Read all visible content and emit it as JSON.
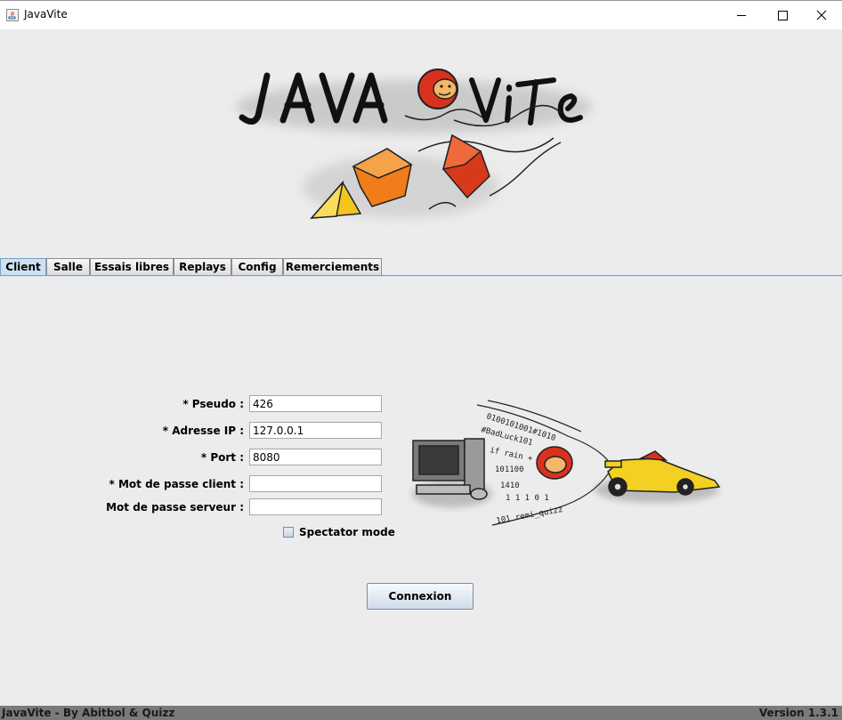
{
  "window": {
    "title": "JavaVite"
  },
  "tabs": [
    {
      "label": "Client",
      "active": true
    },
    {
      "label": "Salle",
      "active": false
    },
    {
      "label": "Essais libres",
      "active": false
    },
    {
      "label": "Replays",
      "active": false
    },
    {
      "label": "Config",
      "active": false
    },
    {
      "label": "Remerciements",
      "active": false
    }
  ],
  "form": {
    "pseudo": {
      "label": "* Pseudo :",
      "value": "426"
    },
    "ip": {
      "label": "* Adresse IP :",
      "value": "127.0.0.1"
    },
    "port": {
      "label": "* Port :",
      "value": "8080"
    },
    "client_password": {
      "label": "* Mot de passe client :",
      "value": ""
    },
    "server_password": {
      "label": "Mot de passe serveur :",
      "value": ""
    },
    "spectator": {
      "label": "Spectator mode",
      "checked": false
    },
    "connect_label": "Connexion"
  },
  "status": {
    "left": "JavaVite - By Abitbol & Quizz",
    "right": "Version 1.3.1"
  },
  "colors": {
    "active_tab": "#cfe0f3",
    "status_bar": "#7a7a7a",
    "logo_orange": "#f07d1a",
    "logo_red": "#d0301a",
    "logo_yellow": "#f3c521"
  }
}
